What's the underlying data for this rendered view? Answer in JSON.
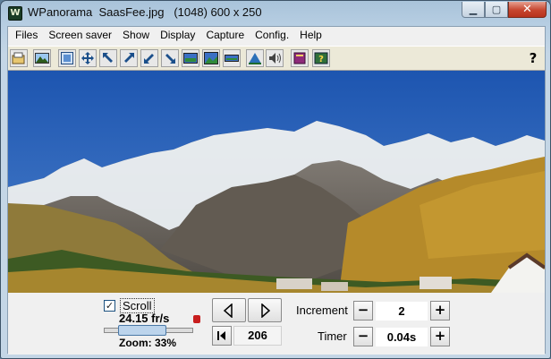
{
  "window": {
    "app_name": "WPanorama",
    "file_name": "SaasFee.jpg",
    "image_info": "(1048) 600 x 250",
    "icon_letter": "W"
  },
  "menu": [
    "Files",
    "Screen saver",
    "Show",
    "Display",
    "Capture",
    "Config.",
    "Help"
  ],
  "toolbar": {
    "icons": [
      "open-icon",
      "picture-icon",
      "fit-window-icon",
      "move-icon",
      "scroll-left-up-icon",
      "scroll-right-up-icon",
      "scroll-left-down-icon",
      "scroll-right-down-icon",
      "panorama-icon",
      "panorama-wide-icon",
      "panorama-strip-icon",
      "landscape-icon",
      "sound-icon",
      "book-icon",
      "help-book-icon"
    ],
    "help_label": "?"
  },
  "controls": {
    "scroll_checked": true,
    "scroll_label": "Scroll",
    "fps": "24.15 fr/s",
    "zoom_label": "Zoom: 33%",
    "zoom_value": 0.33,
    "position": "206",
    "increment_label": "Increment",
    "increment_value": "2",
    "timer_label": "Timer",
    "timer_value": "0.04s",
    "minus": "−",
    "plus": "+",
    "check_mark": "✓"
  },
  "colors": {
    "sky": "#2f62b5",
    "snow": "#eef3f7",
    "rock": "#6d6a66",
    "larch": "#b58a2a",
    "forest": "#3d5a23"
  }
}
